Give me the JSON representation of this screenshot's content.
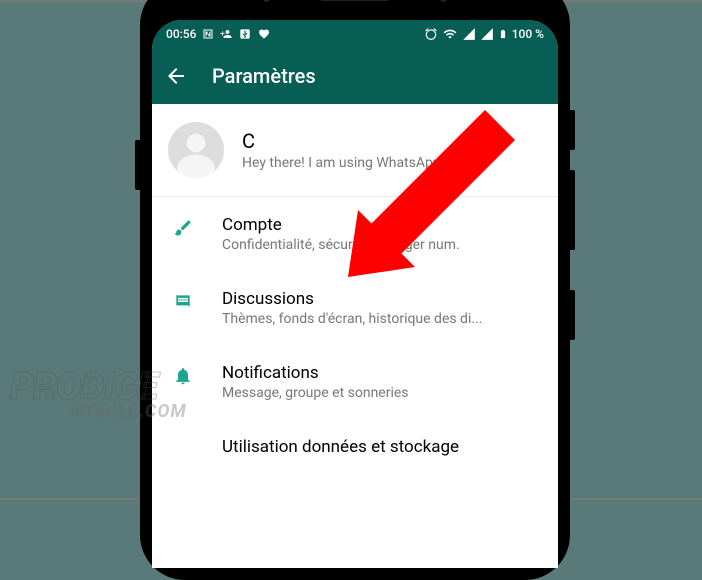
{
  "statusBar": {
    "time": "00:56",
    "battery": "100 %"
  },
  "appBar": {
    "title": "Paramètres"
  },
  "profile": {
    "name": "C",
    "status": "Hey there! I am using WhatsApp."
  },
  "settings": {
    "account": {
      "title": "Compte",
      "subtitle": "Confidentialité, sécurité, changer num."
    },
    "chats": {
      "title": "Discussions",
      "subtitle": "Thèmes, fonds d'écran, historique des di..."
    },
    "notifications": {
      "title": "Notifications",
      "subtitle": "Message, groupe et sonneries"
    },
    "data": {
      "title": "Utilisation données et stockage",
      "subtitle": ""
    }
  },
  "watermark": {
    "line1": "PRODIGE",
    "line2": "MOBILE.COM"
  }
}
